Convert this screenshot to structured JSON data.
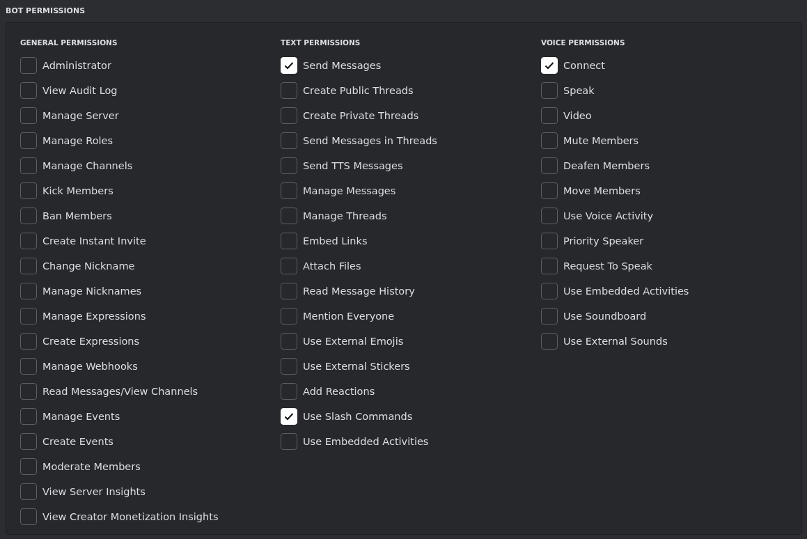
{
  "title": "BOT PERMISSIONS",
  "groups": [
    {
      "heading": "GENERAL PERMISSIONS",
      "permissions": [
        {
          "label": "Administrator",
          "checked": false
        },
        {
          "label": "View Audit Log",
          "checked": false
        },
        {
          "label": "Manage Server",
          "checked": false
        },
        {
          "label": "Manage Roles",
          "checked": false
        },
        {
          "label": "Manage Channels",
          "checked": false
        },
        {
          "label": "Kick Members",
          "checked": false
        },
        {
          "label": "Ban Members",
          "checked": false
        },
        {
          "label": "Create Instant Invite",
          "checked": false
        },
        {
          "label": "Change Nickname",
          "checked": false
        },
        {
          "label": "Manage Nicknames",
          "checked": false
        },
        {
          "label": "Manage Expressions",
          "checked": false
        },
        {
          "label": "Create Expressions",
          "checked": false
        },
        {
          "label": "Manage Webhooks",
          "checked": false
        },
        {
          "label": "Read Messages/View Channels",
          "checked": false
        },
        {
          "label": "Manage Events",
          "checked": false
        },
        {
          "label": "Create Events",
          "checked": false
        },
        {
          "label": "Moderate Members",
          "checked": false
        },
        {
          "label": "View Server Insights",
          "checked": false
        },
        {
          "label": "View Creator Monetization Insights",
          "checked": false
        }
      ]
    },
    {
      "heading": "TEXT PERMISSIONS",
      "permissions": [
        {
          "label": "Send Messages",
          "checked": true
        },
        {
          "label": "Create Public Threads",
          "checked": false
        },
        {
          "label": "Create Private Threads",
          "checked": false
        },
        {
          "label": "Send Messages in Threads",
          "checked": false
        },
        {
          "label": "Send TTS Messages",
          "checked": false
        },
        {
          "label": "Manage Messages",
          "checked": false
        },
        {
          "label": "Manage Threads",
          "checked": false
        },
        {
          "label": "Embed Links",
          "checked": false
        },
        {
          "label": "Attach Files",
          "checked": false
        },
        {
          "label": "Read Message History",
          "checked": false
        },
        {
          "label": "Mention Everyone",
          "checked": false
        },
        {
          "label": "Use External Emojis",
          "checked": false
        },
        {
          "label": "Use External Stickers",
          "checked": false
        },
        {
          "label": "Add Reactions",
          "checked": false
        },
        {
          "label": "Use Slash Commands",
          "checked": true
        },
        {
          "label": "Use Embedded Activities",
          "checked": false
        }
      ]
    },
    {
      "heading": "VOICE PERMISSIONS",
      "permissions": [
        {
          "label": "Connect",
          "checked": true
        },
        {
          "label": "Speak",
          "checked": false
        },
        {
          "label": "Video",
          "checked": false
        },
        {
          "label": "Mute Members",
          "checked": false
        },
        {
          "label": "Deafen Members",
          "checked": false
        },
        {
          "label": "Move Members",
          "checked": false
        },
        {
          "label": "Use Voice Activity",
          "checked": false
        },
        {
          "label": "Priority Speaker",
          "checked": false
        },
        {
          "label": "Request To Speak",
          "checked": false
        },
        {
          "label": "Use Embedded Activities",
          "checked": false
        },
        {
          "label": "Use Soundboard",
          "checked": false
        },
        {
          "label": "Use External Sounds",
          "checked": false
        }
      ]
    }
  ]
}
